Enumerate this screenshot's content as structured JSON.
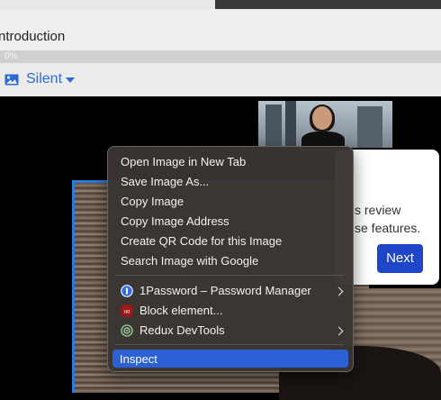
{
  "page": {
    "title_partial": "ntroduction",
    "progress_label": "0%"
  },
  "toolbar": {
    "mode_label": "Silent",
    "icon": "image-icon",
    "dropdown_icon": "caret-down-icon"
  },
  "card": {
    "line1": "s review",
    "line2": "se features.",
    "next_label": "Next"
  },
  "context_menu": {
    "items": [
      {
        "label": "Open Image in New Tab"
      },
      {
        "label": "Save Image As..."
      },
      {
        "label": "Copy Image"
      },
      {
        "label": "Copy Image Address"
      },
      {
        "label": "Create QR Code for this Image"
      },
      {
        "label": "Search Image with Google"
      }
    ],
    "extensions": [
      {
        "label": "1Password – Password Manager",
        "icon": "onepassword-icon",
        "submenu": true
      },
      {
        "label": "Block element...",
        "icon": "ublock-icon",
        "submenu": false
      },
      {
        "label": "Redux DevTools",
        "icon": "redux-icon",
        "submenu": true
      }
    ],
    "inspect_label": "Inspect"
  },
  "colors": {
    "accent": "#2a6bd8",
    "menu_bg": "#3a3532",
    "highlight": "#2b61d4",
    "next_button": "#1f46c8"
  }
}
